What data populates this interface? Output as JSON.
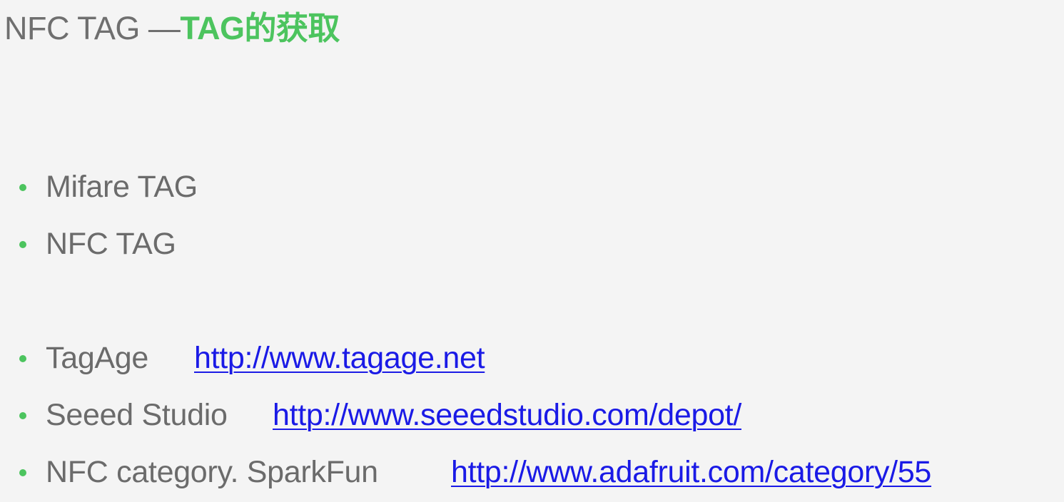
{
  "slide": {
    "title_prefix": "NFC TAG —",
    "title_accent": "TAG的获取",
    "accent_color": "#4cc45e",
    "link_color": "#1a1ae6"
  },
  "bullets": [
    {
      "text": "Mifare TAG",
      "link": ""
    },
    {
      "text": "NFC TAG",
      "link": ""
    },
    {
      "text": "TagAge",
      "link": "http://www.tagage.net"
    },
    {
      "text": "Seeed Studio",
      "link": "http://www.seeedstudio.com/depot/"
    },
    {
      "text": "NFC category. SparkFun",
      "link": "http://www.adafruit.com/category/55"
    }
  ]
}
